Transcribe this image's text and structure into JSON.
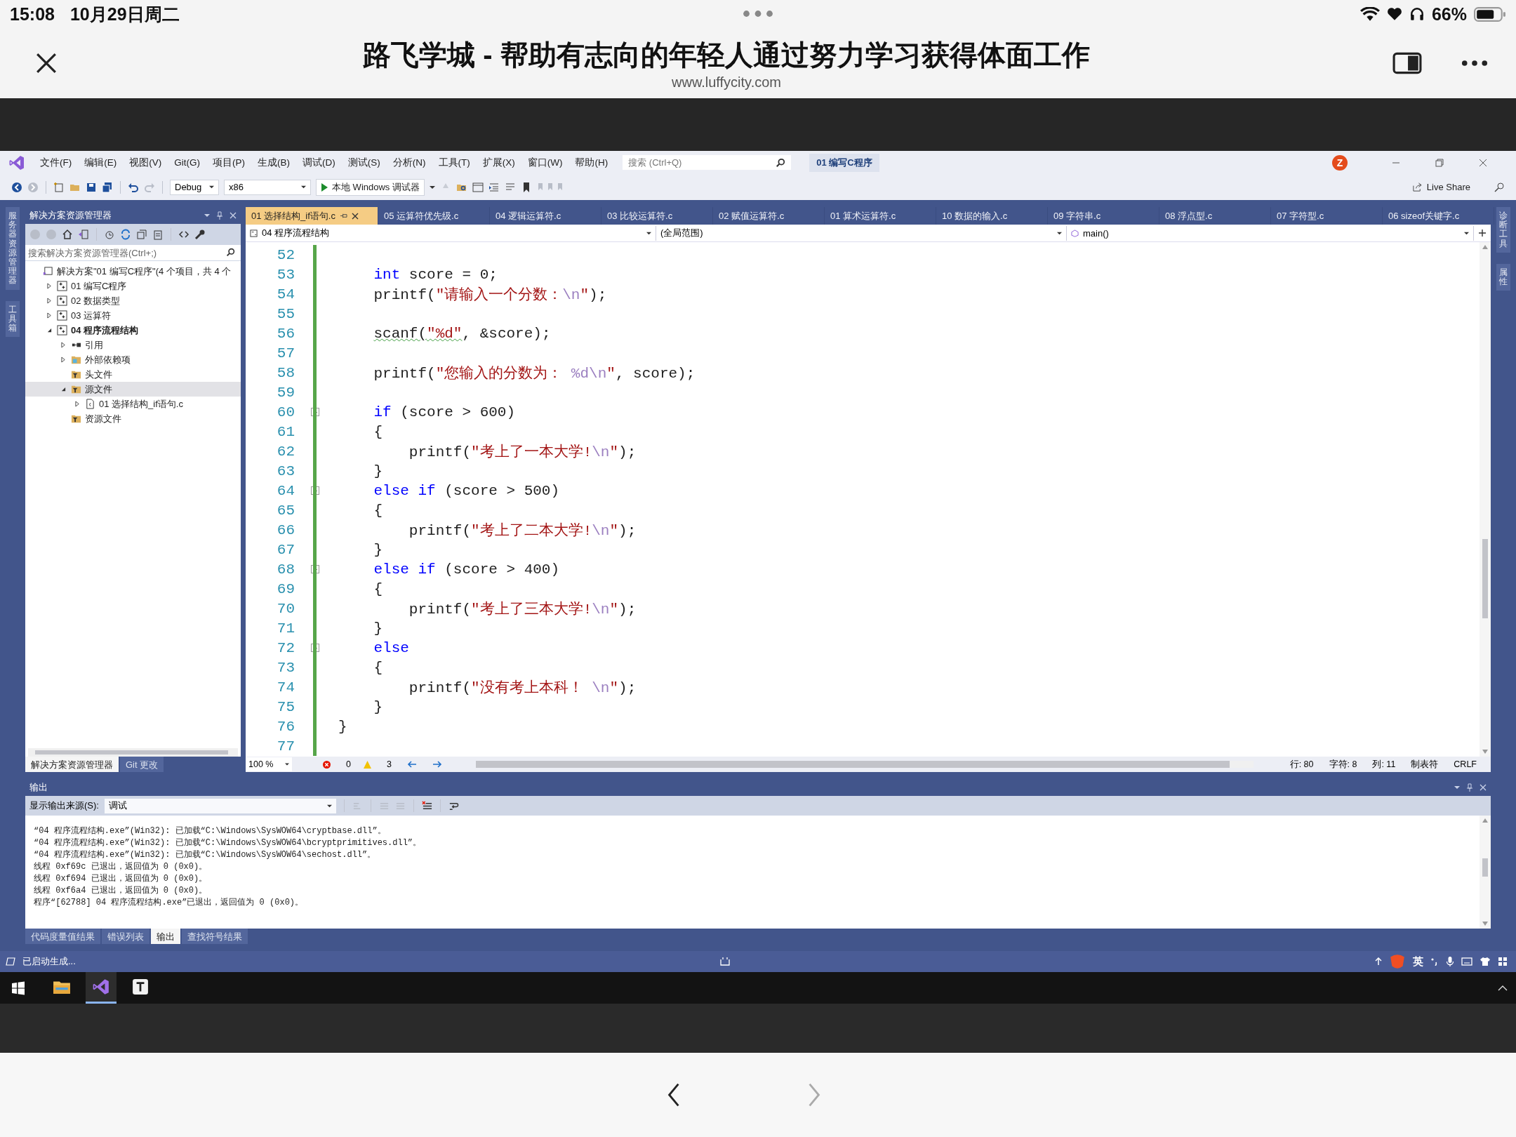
{
  "status_bar": {
    "time": "15:08",
    "date": "10月29日周二",
    "battery": "66%"
  },
  "browser": {
    "title": "路飞学城 - 帮助有志向的年轻人通过努力学习获得体面工作",
    "url": "www.luffycity.com"
  },
  "ide": {
    "menu": [
      "文件(F)",
      "编辑(E)",
      "视图(V)",
      "Git(G)",
      "项目(P)",
      "生成(B)",
      "调试(D)",
      "测试(S)",
      "分析(N)",
      "工具(T)",
      "扩展(X)",
      "窗口(W)",
      "帮助(H)"
    ],
    "search": {
      "placeholder": "搜索 (Ctrl+Q)"
    },
    "solution_name": "01 编写C程序",
    "avatar": "Z",
    "toolbar": {
      "configuration": "Debug",
      "platform": "x86",
      "run_button": "本地 Windows 调试器",
      "live_share": "Live Share"
    },
    "left_strip": [
      "服务器资源管理器",
      "工具箱"
    ],
    "right_strip": [
      "诊断工具",
      "属性"
    ],
    "solution_explorer": {
      "title": "解决方案资源管理器",
      "search": {
        "placeholder": "搜索解决方案资源管理器(Ctrl+;)"
      },
      "tree": [
        {
          "label": "解决方案\"01 编写C程序\"(4 个项目，共 4 个",
          "kind": "solution",
          "selected": false,
          "children": [
            {
              "label": "01 编写C程序",
              "kind": "project",
              "expanded": false,
              "startup": false,
              "selected": false
            },
            {
              "label": "02 数据类型",
              "kind": "project",
              "expanded": false,
              "startup": false,
              "selected": false
            },
            {
              "label": "03 运算符",
              "kind": "project",
              "expanded": false,
              "startup": false,
              "selected": false
            },
            {
              "label": "04 程序流程结构",
              "kind": "project",
              "expanded": true,
              "startup": true,
              "selected": false,
              "children": [
                {
                  "label": "引用",
                  "kind": "references",
                  "expanded": false,
                  "selected": false
                },
                {
                  "label": "外部依赖项",
                  "kind": "external",
                  "expanded": false,
                  "selected": false
                },
                {
                  "label": "头文件",
                  "kind": "filter",
                  "selected": false
                },
                {
                  "label": "源文件",
                  "kind": "filter",
                  "expanded": true,
                  "selected": true,
                  "children": [
                    {
                      "label": "01 选择结构_if语句.c",
                      "kind": "file",
                      "expanded": false,
                      "selected": false
                    }
                  ]
                },
                {
                  "label": "资源文件",
                  "kind": "filter",
                  "selected": false
                }
              ]
            }
          ]
        }
      ],
      "tabs": [
        {
          "label": "解决方案资源管理器",
          "selected": true
        },
        {
          "label": "Git 更改",
          "selected": false
        }
      ]
    },
    "editor": {
      "tabs": [
        {
          "label": "01 选择结构_if语句.c",
          "selected": true
        },
        {
          "label": "05 运算符优先级.c",
          "selected": false
        },
        {
          "label": "04 逻辑运算符.c",
          "selected": false
        },
        {
          "label": "03 比较运算符.c",
          "selected": false
        },
        {
          "label": "02 赋值运算符.c",
          "selected": false
        },
        {
          "label": "01 算术运算符.c",
          "selected": false
        },
        {
          "label": "10 数据的输入.c",
          "selected": false
        },
        {
          "label": "09 字符串.c",
          "selected": false
        },
        {
          "label": "08 浮点型.c",
          "selected": false
        },
        {
          "label": "07 字符型.c",
          "selected": false
        },
        {
          "label": "06 sizeof关键字.c",
          "selected": false
        }
      ],
      "nav": {
        "project": "04 程序流程结构",
        "scope": "(全局范围)",
        "member": "main()"
      },
      "lines": [
        {
          "number": "52",
          "fold": false
        },
        {
          "number": "53",
          "fold": false,
          "warning": false,
          "tokens": [
            {
              "t": "    int",
              "kind": "keyword"
            },
            {
              "t": " score = 0;",
              "kind": "plain"
            }
          ]
        },
        {
          "number": "54",
          "fold": false,
          "warning": false,
          "tokens": [
            {
              "t": "    printf(",
              "kind": "plain"
            },
            {
              "t": "\"请输入一个分数：",
              "kind": "string"
            },
            {
              "t": "\\n",
              "kind": "escape"
            },
            {
              "t": "\"",
              "kind": "string"
            },
            {
              "t": ");",
              "kind": "plain"
            }
          ]
        },
        {
          "number": "55",
          "fold": false
        },
        {
          "number": "56",
          "fold": false,
          "warning": true,
          "tokens": [
            {
              "t": "    scanf(",
              "kind": "plain"
            },
            {
              "t": "\"%d\"",
              "kind": "string"
            },
            {
              "t": ", &score);",
              "kind": "plain"
            }
          ]
        },
        {
          "number": "57",
          "fold": false
        },
        {
          "number": "58",
          "fold": false,
          "warning": false,
          "tokens": [
            {
              "t": "    printf(",
              "kind": "plain"
            },
            {
              "t": "\"您输入的分数为： ",
              "kind": "string"
            },
            {
              "t": "%d\\n",
              "kind": "escape"
            },
            {
              "t": "\"",
              "kind": "string"
            },
            {
              "t": ", score);",
              "kind": "plain"
            }
          ]
        },
        {
          "number": "59",
          "fold": false
        },
        {
          "number": "60",
          "fold": true,
          "warning": false,
          "tokens": [
            {
              "t": "    if",
              "kind": "keyword"
            },
            {
              "t": " (score > 600)",
              "kind": "plain"
            }
          ]
        },
        {
          "number": "61",
          "fold": false,
          "warning": false,
          "tokens": [
            {
              "t": "    {",
              "kind": "plain"
            }
          ]
        },
        {
          "number": "62",
          "fold": false,
          "warning": false,
          "tokens": [
            {
              "t": "        printf(",
              "kind": "plain"
            },
            {
              "t": "\"考上了一本大学!",
              "kind": "string"
            },
            {
              "t": "\\n",
              "kind": "escape"
            },
            {
              "t": "\"",
              "kind": "string"
            },
            {
              "t": ");",
              "kind": "plain"
            }
          ]
        },
        {
          "number": "63",
          "fold": false,
          "warning": false,
          "tokens": [
            {
              "t": "    }",
              "kind": "plain"
            }
          ]
        },
        {
          "number": "64",
          "fold": true,
          "warning": false,
          "tokens": [
            {
              "t": "    else if",
              "kind": "keyword"
            },
            {
              "t": " (score > 500)",
              "kind": "plain"
            }
          ]
        },
        {
          "number": "65",
          "fold": false,
          "warning": false,
          "tokens": [
            {
              "t": "    {",
              "kind": "plain"
            }
          ]
        },
        {
          "number": "66",
          "fold": false,
          "warning": false,
          "tokens": [
            {
              "t": "        printf(",
              "kind": "plain"
            },
            {
              "t": "\"考上了二本大学!",
              "kind": "string"
            },
            {
              "t": "\\n",
              "kind": "escape"
            },
            {
              "t": "\"",
              "kind": "string"
            },
            {
              "t": ");",
              "kind": "plain"
            }
          ]
        },
        {
          "number": "67",
          "fold": false,
          "warning": false,
          "tokens": [
            {
              "t": "    }",
              "kind": "plain"
            }
          ]
        },
        {
          "number": "68",
          "fold": true,
          "warning": false,
          "tokens": [
            {
              "t": "    else if",
              "kind": "keyword"
            },
            {
              "t": " (score > 400)",
              "kind": "plain"
            }
          ]
        },
        {
          "number": "69",
          "fold": false,
          "warning": false,
          "tokens": [
            {
              "t": "    {",
              "kind": "plain"
            }
          ]
        },
        {
          "number": "70",
          "fold": false,
          "warning": false,
          "tokens": [
            {
              "t": "        printf(",
              "kind": "plain"
            },
            {
              "t": "\"考上了三本大学!",
              "kind": "string"
            },
            {
              "t": "\\n",
              "kind": "escape"
            },
            {
              "t": "\"",
              "kind": "string"
            },
            {
              "t": ");",
              "kind": "plain"
            }
          ]
        },
        {
          "number": "71",
          "fold": false,
          "warning": false,
          "tokens": [
            {
              "t": "    }",
              "kind": "plain"
            }
          ]
        },
        {
          "number": "72",
          "fold": true,
          "warning": false,
          "tokens": [
            {
              "t": "    else",
              "kind": "keyword"
            }
          ]
        },
        {
          "number": "73",
          "fold": false,
          "warning": false,
          "tokens": [
            {
              "t": "    {",
              "kind": "plain"
            }
          ]
        },
        {
          "number": "74",
          "fold": false,
          "warning": false,
          "tokens": [
            {
              "t": "        printf(",
              "kind": "plain"
            },
            {
              "t": "\"没有考上本科！ ",
              "kind": "string"
            },
            {
              "t": "\\n",
              "kind": "escape"
            },
            {
              "t": "\"",
              "kind": "string"
            },
            {
              "t": ");",
              "kind": "plain"
            }
          ]
        },
        {
          "number": "75",
          "fold": false,
          "warning": false,
          "tokens": [
            {
              "t": "    }",
              "kind": "plain"
            }
          ]
        },
        {
          "number": "76",
          "fold": false,
          "warning": false,
          "tokens": [
            {
              "t": "}",
              "kind": "plain"
            }
          ]
        },
        {
          "number": "77",
          "fold": false
        }
      ],
      "status": {
        "zoom": "100 %",
        "errors": "0",
        "warnings": "3",
        "line": "行: 80",
        "char": "字符: 8",
        "col": "列: 11",
        "tabs": "制表符",
        "eol": "CRLF"
      }
    },
    "output": {
      "title": "输出",
      "source_label": "显示输出来源(S):",
      "source": "调试",
      "lines": [
        "“04 程序流程结构.exe”(Win32): 已加载“C:\\Windows\\SysWOW64\\cryptbase.dll”。",
        "“04 程序流程结构.exe”(Win32): 已加载“C:\\Windows\\SysWOW64\\bcryptprimitives.dll”。",
        "“04 程序流程结构.exe”(Win32): 已加载“C:\\Windows\\SysWOW64\\sechost.dll”。",
        "线程 0xf69c 已退出，返回值为 0 (0x0)。",
        "线程 0xf694 已退出，返回值为 0 (0x0)。",
        "线程 0xf6a4 已退出，返回值为 0 (0x0)。",
        "程序“[62788] 04 程序流程结构.exe”已退出，返回值为 0 (0x0)。"
      ],
      "tabs": [
        {
          "label": "代码度量值结果",
          "selected": false
        },
        {
          "label": "错误列表",
          "selected": false
        },
        {
          "label": "输出",
          "selected": true
        },
        {
          "label": "查找符号结果",
          "selected": false
        }
      ]
    },
    "status": {
      "text": "已启动生成...",
      "ime": "英"
    }
  },
  "taskbar": {
    "apps": [
      {
        "kind": "explorer",
        "selected": false
      },
      {
        "kind": "vs",
        "selected": true
      },
      {
        "kind": "notes",
        "selected": false
      }
    ]
  }
}
